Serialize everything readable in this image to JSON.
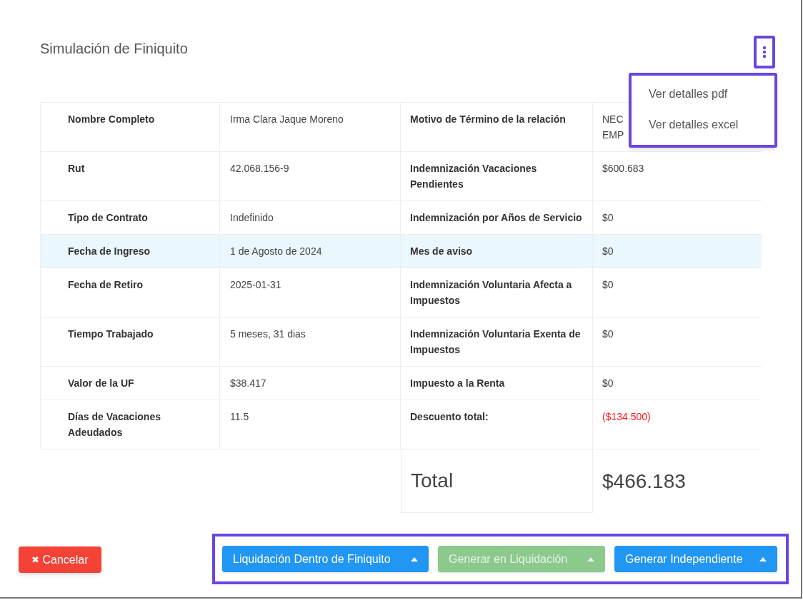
{
  "title": "Simulación de Finiquito",
  "menu": {
    "items": [
      {
        "label": "Ver detalles pdf"
      },
      {
        "label": "Ver detalles excel"
      }
    ]
  },
  "rows": [
    {
      "label": "Nombre Completo",
      "value": "Irma Clara Jaque Moreno",
      "label_2": "Motivo de Término de la relación",
      "value_2": [
        "NEC",
        "EMP"
      ],
      "highlighted": false,
      "kind": "normal"
    },
    {
      "label": "Rut",
      "value": "42.068.156-9",
      "label_2": "Indemnización Vacaciones Pendientes",
      "value_2": [
        "$600.683"
      ],
      "highlighted": false,
      "kind": "normal"
    },
    {
      "label": "Tipo de Contrato",
      "value": "Indefinido",
      "label_2": "Indemnización por Años de Servicio",
      "value_2": [
        "$0"
      ],
      "highlighted": false,
      "kind": "normal"
    },
    {
      "label": "Fecha de Ingreso",
      "value": "1 de Agosto de 2024",
      "label_2": "Mes de aviso",
      "value_2": [
        "$0"
      ],
      "highlighted": true,
      "kind": "normal"
    },
    {
      "label": "Fecha de Retiro",
      "value": "2025-01-31",
      "label_2": "Indemnización Voluntaria Afecta a Impuestos",
      "value_2": [
        "$0"
      ],
      "highlighted": false,
      "kind": "normal"
    },
    {
      "label": "Tiempo Trabajado",
      "value": "5 meses, 31 dias",
      "label_2": "Indemnización Voluntaria Exenta de Impuestos",
      "value_2": [
        "$0"
      ],
      "highlighted": false,
      "kind": "normal"
    },
    {
      "label": "Valor de la UF",
      "value": "$38.417",
      "label_2": "Impuesto a la Renta",
      "value_2": [
        "$0"
      ],
      "highlighted": false,
      "kind": "normal"
    },
    {
      "label": "Días de Vacaciones Adeudados",
      "value": "11.5",
      "label_2": "Descuento total:",
      "value_2": [
        "($134.500)"
      ],
      "highlighted": false,
      "kind": "negative"
    }
  ],
  "total": {
    "label": "Total",
    "value": "$466.183"
  },
  "cancel_button": {
    "icon": "✖",
    "label": "Cancelar"
  },
  "action_buttons": [
    {
      "label": "Liquidación Dentro de Finiquito",
      "color": "#2196f3",
      "disabled": false
    },
    {
      "label": "Generar en Liquidación",
      "color": "#8bc98d",
      "disabled": true
    },
    {
      "label": "Generar Independiente",
      "color": "#2196f3",
      "disabled": false
    }
  ]
}
